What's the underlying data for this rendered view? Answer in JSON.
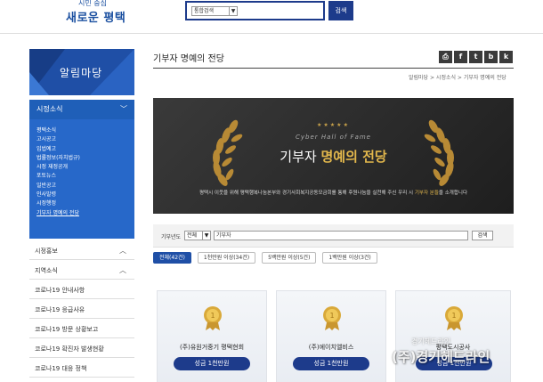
{
  "header": {
    "logo_small": "시민 중심",
    "logo_main": "새로운 평택",
    "search_select": "통합검색",
    "search_button": "검색"
  },
  "sidebar": {
    "banner_title": "알림마당",
    "menu_head": "시정소식",
    "sub_items": [
      {
        "label": "평택소식"
      },
      {
        "label": "고시공고"
      },
      {
        "label": "입법예고"
      },
      {
        "label": "법률정보(자치법규)"
      },
      {
        "label": "시정 재정공개"
      },
      {
        "label": "포토뉴스"
      },
      {
        "label": "일반공고"
      },
      {
        "label": "인사발령"
      },
      {
        "label": "시정행정"
      },
      {
        "label": "기부자 명예의 전당"
      }
    ],
    "rows": [
      {
        "label": "시정홍보",
        "chevron": "︿"
      },
      {
        "label": "지역소식",
        "chevron": "︿"
      },
      {
        "label": "코로나19 안내사항",
        "chevron": ""
      },
      {
        "label": "코로나19 응급사유",
        "chevron": ""
      },
      {
        "label": "코로나19 방문 상황보고",
        "chevron": ""
      },
      {
        "label": "코로나19 확진자 발생현황",
        "chevron": ""
      },
      {
        "label": "코로나19 대응 정책",
        "chevron": ""
      }
    ]
  },
  "main": {
    "page_title": "기부자 명예의 전당",
    "breadcrumb": "알림마당 > 시정소식 > 기부자 명예의 전당",
    "share_icons": [
      "print-icon",
      "facebook-icon",
      "twitter-icon",
      "blog-icon",
      "kakao-icon"
    ],
    "hero": {
      "stars": "★★★★★",
      "subtitle": "Cyber Hall of Fame",
      "title_plain": "기부자 ",
      "title_gold": "명예의 전당",
      "desc_plain": "평택시 이웃을 위해 평택행복나눔본부와 경기사회복지공동모금회를 통해 후원나눔을 실천해 주신 우리 시 ",
      "desc_gold": "기부자 분들",
      "desc_tail": "을 소개합니다"
    },
    "filter": {
      "label": "기부년도",
      "select": "전체",
      "input_value": "기부자",
      "button": "검색"
    },
    "tabs": [
      {
        "label": "전체(42건)",
        "active": true
      },
      {
        "label": "1천만원 이상(34건)",
        "active": false
      },
      {
        "label": "5백만원 이상(5건)",
        "active": false
      },
      {
        "label": "1백만원 이상(3건)",
        "active": false
      }
    ],
    "cards": [
      {
        "name": "(주)유원거중기 평택현회",
        "badge": "성금 1천만원"
      },
      {
        "name": "(주)에이치엘비스",
        "badge": "성금 1천만원"
      },
      {
        "name": "평택도시공사",
        "badge": "성금 1천만원"
      }
    ]
  },
  "watermark": {
    "top": "경기헤드라인",
    "main": "(주)경기헤드라인"
  },
  "colors": {
    "primary": "#1d3b8b",
    "sidebar_blue": "#2768c9",
    "gold": "#e2b74c",
    "hero_bg": "#2b2b2b"
  }
}
